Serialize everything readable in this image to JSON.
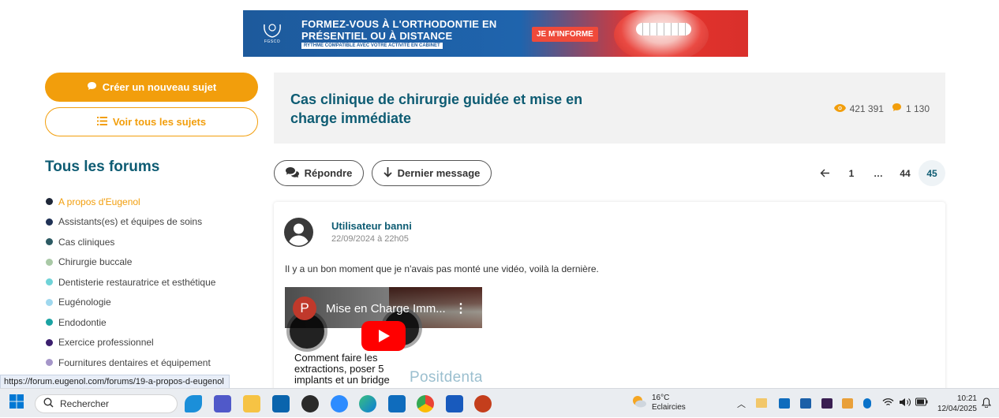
{
  "banner": {
    "line1": "FORMEZ-VOUS À L'ORTHODONTIE EN",
    "line2": "PRÉSENTIEL OU À DISTANCE",
    "line3": "RYTHME COMPATIBLE AVEC VOTRE ACTIVITÉ EN CABINET",
    "cta": "JE M'INFORME",
    "logo_text": "FGSCO"
  },
  "sidebar": {
    "create_label": "Créer un nouveau sujet",
    "all_topics_label": "Voir tous les sujets",
    "forums_title": "Tous les forums",
    "forums": [
      {
        "label": "A propos d'Eugenol",
        "color": "#1e2738",
        "active": true
      },
      {
        "label": "Assistants(es) et équipes de soins",
        "color": "#1f3155"
      },
      {
        "label": "Cas cliniques",
        "color": "#2c5a63"
      },
      {
        "label": "Chirurgie buccale",
        "color": "#a9c9a6"
      },
      {
        "label": "Dentisterie restauratrice et esthétique",
        "color": "#6fd3d8"
      },
      {
        "label": "Eugénologie",
        "color": "#9fd8ee"
      },
      {
        "label": "Endodontie",
        "color": "#1aa3a3"
      },
      {
        "label": "Exercice professionnel",
        "color": "#3b1f6e"
      },
      {
        "label": "Fournitures dentaires et équipement",
        "color": "#a596c9"
      }
    ]
  },
  "topic": {
    "title": "Cas clinique de chirurgie guidée et mise en charge immédiate",
    "views": "421 391",
    "replies": "1 130"
  },
  "actions": {
    "reply_label": "Répondre",
    "last_label": "Dernier message"
  },
  "pagination": {
    "first": "1",
    "ellipsis": "…",
    "prev_page": "44",
    "current": "45"
  },
  "post": {
    "author": "Utilisateur banni",
    "date": "22/09/2024 à 22h05",
    "message": "Il y a un bon moment que je n'avais pas monté une vidéo, voilà la dernière.",
    "video": {
      "channel_initial": "P",
      "title": "Mise en Charge Imm...",
      "caption": "Comment faire les extractions, poser 5 implants et un bridge",
      "brand": "Positdental"
    }
  },
  "status_url": "https://forum.eugenol.com/forums/19-a-propos-d-eugenol",
  "taskbar": {
    "search_placeholder": "Rechercher",
    "weather_temp": "16°C",
    "weather_desc": "Eclaircies",
    "time": "10:21",
    "date": "12/04/2025",
    "accent": "#0078d4"
  }
}
